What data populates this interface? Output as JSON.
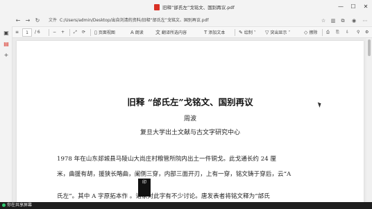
{
  "window": {
    "title": "旧释“邰氏左”戈铭文、国别再议.pdf",
    "controls": [
      "minimize",
      "maximize",
      "close"
    ]
  },
  "address": {
    "label": "文件",
    "url": "C:/Users/admin/Desktop/出自刘清的资料/旧释“邰氏左”戈铭文、国别再议.pdf"
  },
  "toolbar": {
    "page_current": "1",
    "page_total": "/ 6",
    "zoom_out": "−",
    "zoom_in": "+",
    "page_view": "页面视图",
    "read_aloud": "朗读",
    "translate": "翻译所选内容",
    "add_text": "添加文本",
    "draw": "绘制",
    "highlight": "突出显示",
    "erase": "擦除"
  },
  "document": {
    "title": "旧释  “邰氏左”戈铭文、国别再议",
    "author": "周波",
    "affiliation": "复旦大学出土文献与古文字研究中心",
    "paragraph_lines": [
      "1978 年在山东郯城县马陵山大尚庄村粮管所院内出土一件铜戈。此戈通长约 24 厘",
      "米，曲援有胡，援狭长略曲，阑侧三穿，内部三面开刃，上有一穿，铭文铸于穿后，云“A",
      "氏左”。其中 A 字原拓本作      。诸家对此字有不少讨论。唐发表者将铭文释为“邰氏"
    ],
    "stamp_text": "印"
  },
  "status": {
    "share_text": "你在共享屏幕"
  }
}
